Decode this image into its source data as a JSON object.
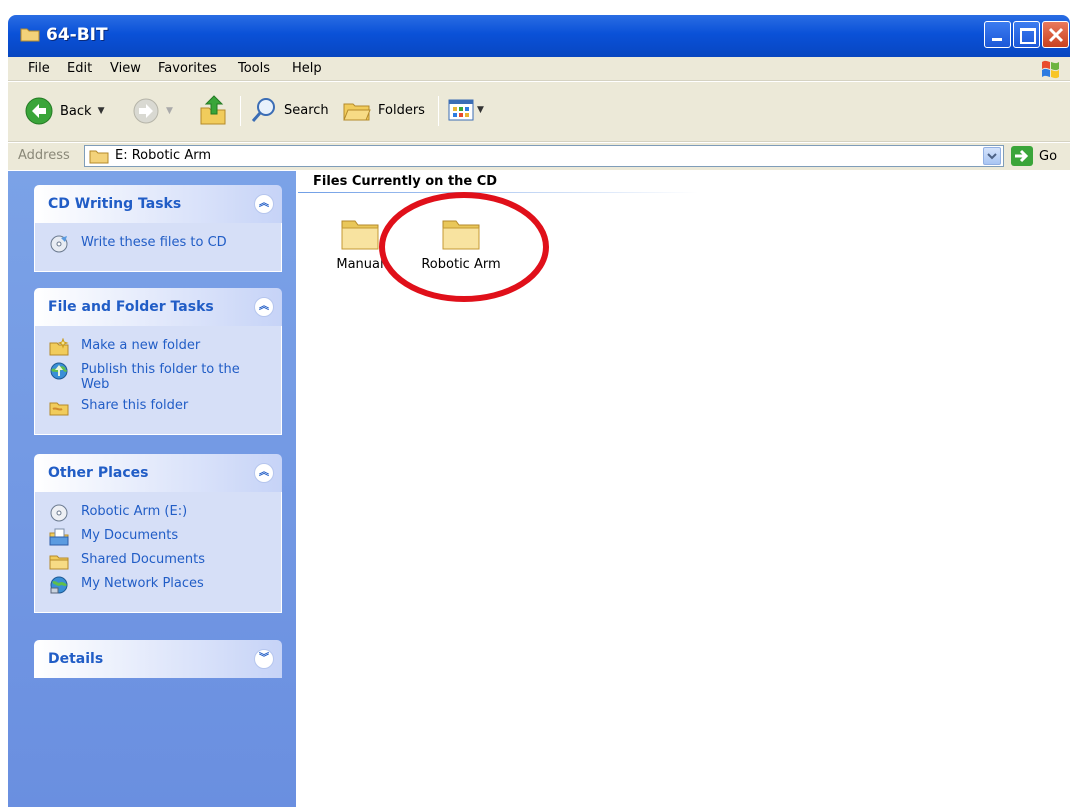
{
  "window": {
    "title": "64-BIT",
    "minimize_icon": "minimize-icon",
    "maximize_icon": "maximize-icon",
    "close_icon": "close-icon"
  },
  "menu": {
    "items": [
      "File",
      "Edit",
      "View",
      "Favorites",
      "Tools",
      "Help"
    ]
  },
  "toolbar": {
    "back_label": "Back",
    "search_label": "Search",
    "folders_label": "Folders"
  },
  "address": {
    "label": "Address",
    "value": "E: Robotic Arm",
    "go_label": "Go"
  },
  "task_pane": {
    "cd_writing": {
      "title": "CD Writing Tasks",
      "tasks": [
        {
          "label": "Write these files to CD",
          "icon": "cd-write-icon"
        }
      ]
    },
    "file_folder": {
      "title": "File and Folder Tasks",
      "tasks": [
        {
          "label": "Make a new folder",
          "icon": "new-folder-icon"
        },
        {
          "label": "Publish this folder to the Web",
          "icon": "publish-web-icon"
        },
        {
          "label": "Share this folder",
          "icon": "share-folder-icon"
        }
      ]
    },
    "other_places": {
      "title": "Other Places",
      "places": [
        {
          "label": "Robotic Arm (E:)",
          "icon": "cd-drive-icon"
        },
        {
          "label": "My Documents",
          "icon": "my-documents-icon"
        },
        {
          "label": "Shared Documents",
          "icon": "shared-folder-icon"
        },
        {
          "label": "My Network Places",
          "icon": "network-places-icon"
        }
      ]
    },
    "details": {
      "title": "Details"
    }
  },
  "content": {
    "group_title": "Files Currently on the CD",
    "folders": [
      {
        "name": "Manual"
      },
      {
        "name": "Robotic Arm"
      }
    ]
  },
  "colors": {
    "title_bar": "#0a51d8",
    "task_pane": "#6a8fe0",
    "link": "#215dc6",
    "highlight": "#e0101a"
  }
}
